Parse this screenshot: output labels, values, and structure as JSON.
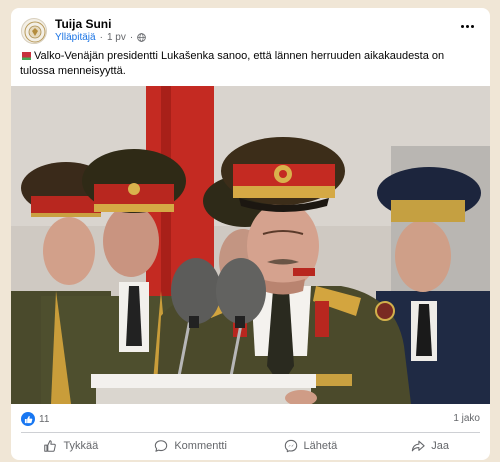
{
  "post": {
    "author": "Tuija Suni",
    "role": "Ylläpitäjä",
    "separator": "·",
    "time": "1 pv",
    "text": "Valko-Venäjän presidentti Lukašenka sanoo, että lännen herruuden aikakaudesta on tulossa menneisyyttä.",
    "flag_icon": "belarus-flag-icon",
    "visibility_icon": "globe-icon"
  },
  "engagement": {
    "reaction_count": "11",
    "shares": "1 jako"
  },
  "actions": {
    "like": "Tykkää",
    "comment": "Kommentti",
    "send": "Lähetä",
    "share": "Jaa"
  },
  "colors": {
    "accent": "#1877f2",
    "secondary_text": "#65676b",
    "background": "#f0e6d6"
  }
}
